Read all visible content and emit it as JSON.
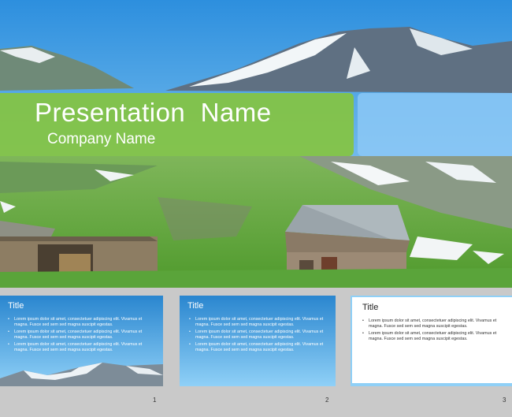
{
  "title": {
    "presentation_name": "Presentation  Name",
    "company_name": "Company Name"
  },
  "thumbnails": [
    {
      "number": "1",
      "title": "Title",
      "bullets": [
        "Lorem ipsum dolor sit amet, consectetuer adipiscing elit. Vivamus et magna. Fusce sed sem sed magna suscipit egestas.",
        "Lorem ipsum dolor sit amet, consectetuer adipiscing elit. Vivamus et magna. Fusce sed sem sed magna suscipit egestas.",
        "Lorem ipsum dolor sit amet, consectetuer adipiscing elit. Vivamus et magna. Fusce sed sem sed magna suscipit egestas."
      ]
    },
    {
      "number": "2",
      "title": "Title",
      "bullets": [
        "Lorem ipsum dolor sit amet, consectetuer adipiscing elit. Vivamus et magna. Fusce sed sem sed magna suscipit egestas.",
        "Lorem ipsum dolor sit amet, consectetuer adipiscing elit. Vivamus et magna. Fusce sed sem sed magna suscipit egestas.",
        "Lorem ipsum dolor sit amet, consectetuer adipiscing elit. Vivamus et magna. Fusce sed sem sed magna suscipit egestas."
      ]
    },
    {
      "number": "3",
      "title": "Title",
      "bullets": [
        "Lorem ipsum dolor sit amet, consectetuer adipiscing elit. Vivamus et magna. Fusce sed sem sed magna suscipit egestas.",
        "Lorem ipsum dolor sit amet, consectetuer adipiscing elit. Vivamus et magna. Fusce sed sem sed magna suscipit egestas."
      ]
    }
  ],
  "colors": {
    "sky": "#4aa5e6",
    "title_band": "#84c442",
    "accent_blue": "#8cc8f5",
    "grass": "#5ea83a"
  }
}
